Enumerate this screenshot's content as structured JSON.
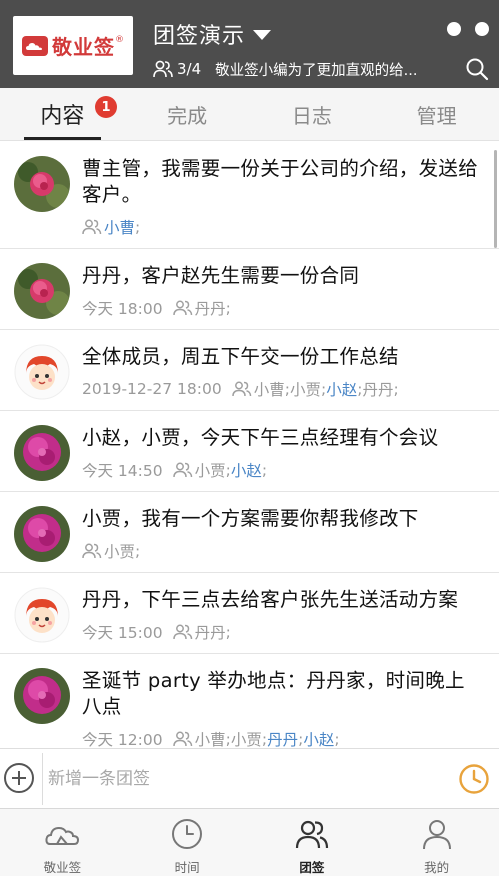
{
  "header": {
    "logo_text": "敬业签",
    "logo_mark": "®",
    "group_title": "团签演示",
    "progress": "3/4",
    "announcement": "敬业签小编为了更加直观的给..."
  },
  "tabs": [
    {
      "label": "内容",
      "badge": "1",
      "active": true
    },
    {
      "label": "完成",
      "active": false
    },
    {
      "label": "日志",
      "active": false
    },
    {
      "label": "管理",
      "active": false
    }
  ],
  "items": [
    {
      "avatar": "rose",
      "text": "曹主管，我需要一份关于公司的介绍，发送给客户。",
      "time": "",
      "people": [
        {
          "name": "小曹",
          "hl": true
        }
      ]
    },
    {
      "avatar": "rose",
      "text": "丹丹，客户赵先生需要一份合同",
      "time": "今天 18:00",
      "people": [
        {
          "name": "丹丹",
          "hl": false
        }
      ]
    },
    {
      "avatar": "cartoon",
      "text": "全体成员，周五下午交一份工作总结",
      "time": "2019-12-27 18:00",
      "people": [
        {
          "name": "小曹",
          "hl": false
        },
        {
          "name": "小贾",
          "hl": false
        },
        {
          "name": "小赵",
          "hl": true
        },
        {
          "name": "丹丹",
          "hl": false
        }
      ]
    },
    {
      "avatar": "pink",
      "text": "小赵，小贾，今天下午三点经理有个会议",
      "time": "今天 14:50",
      "people": [
        {
          "name": "小贾",
          "hl": false
        },
        {
          "name": "小赵",
          "hl": true
        }
      ]
    },
    {
      "avatar": "pink",
      "text": "小贾，我有一个方案需要你帮我修改下",
      "time": "",
      "people": [
        {
          "name": "小贾",
          "hl": false
        }
      ]
    },
    {
      "avatar": "cartoon",
      "text": "丹丹，下午三点去给客户张先生送活动方案",
      "time": "今天 15:00",
      "people": [
        {
          "name": "丹丹",
          "hl": false
        }
      ]
    },
    {
      "avatar": "pink",
      "text": "圣诞节 party 举办地点：丹丹家，时间晚上八点",
      "time": "今天 12:00",
      "people": [
        {
          "name": "小曹",
          "hl": false
        },
        {
          "name": "小贾",
          "hl": false
        },
        {
          "name": "丹丹",
          "hl": true
        },
        {
          "name": "小赵",
          "hl": true
        }
      ]
    }
  ],
  "input": {
    "placeholder": "新增一条团签"
  },
  "nav": [
    {
      "label": "敬业签",
      "icon": "cloud-icon",
      "active": false
    },
    {
      "label": "时间",
      "icon": "clock-icon",
      "active": false
    },
    {
      "label": "团签",
      "icon": "group-icon",
      "active": true
    },
    {
      "label": "我的",
      "icon": "person-icon",
      "active": false
    }
  ],
  "colors": {
    "header_bg": "#4d4d4d",
    "badge": "#e03c31",
    "highlight_name": "#4b86c6",
    "clock_accent": "#e8a33c"
  }
}
